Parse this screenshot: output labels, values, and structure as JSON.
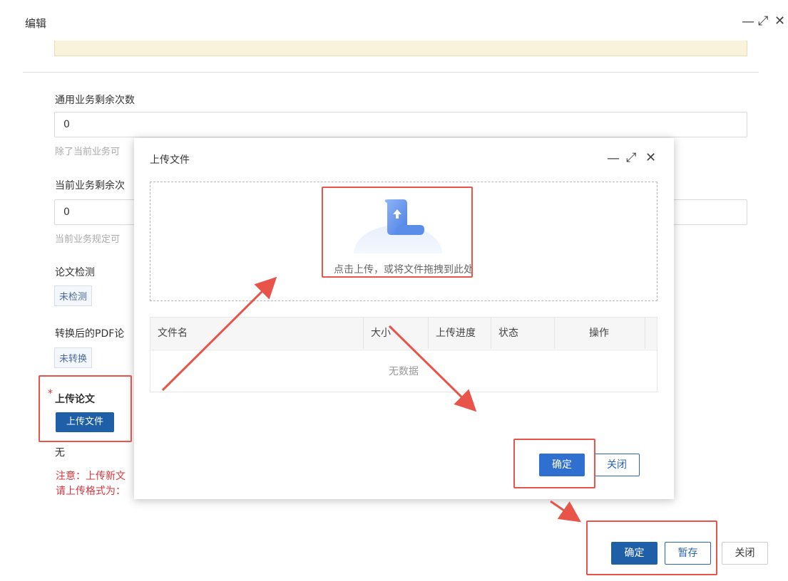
{
  "outer": {
    "title": "编辑",
    "window_controls": {
      "minimize": "—",
      "maximize": "⤢",
      "close": "✕"
    },
    "fields": {
      "general_remaining_label": "通用业务剩余次数",
      "general_remaining_value": "0",
      "general_remaining_hint": "除了当前业务可",
      "current_remaining_label": "当前业务剩余次",
      "current_remaining_value": "0",
      "current_remaining_hint": "当前业务规定可",
      "paper_check_label": "论文检测",
      "paper_check_status": "未检测",
      "pdf_label": "转换后的PDF论",
      "pdf_status": "未转换",
      "upload_paper_required_mark": "*",
      "upload_paper_label": "上传论文",
      "upload_file_button": "上传文件",
      "upload_file_value": "无",
      "note_line1": "注意：上传新文",
      "note_line2": "请上传格式为："
    },
    "footer": {
      "confirm": "确定",
      "save_draft": "暂存",
      "close": "关闭"
    }
  },
  "modal": {
    "title": "上传文件",
    "window_controls": {
      "minimize": "—",
      "maximize": "⤢",
      "close": "✕"
    },
    "dropzone_text": "点击上传，或将文件拖拽到此处",
    "table": {
      "columns": [
        "文件名",
        "大小",
        "上传进度",
        "状态",
        "操作"
      ],
      "empty_text": "无数据"
    },
    "footer": {
      "confirm": "确定",
      "close": "关闭"
    }
  },
  "colors": {
    "primary": "#1e5fa8",
    "annotation_red": "#e8534a",
    "note_red": "#d9363e"
  },
  "icons": {
    "upload_illustration": "upload-cloud-icon"
  }
}
